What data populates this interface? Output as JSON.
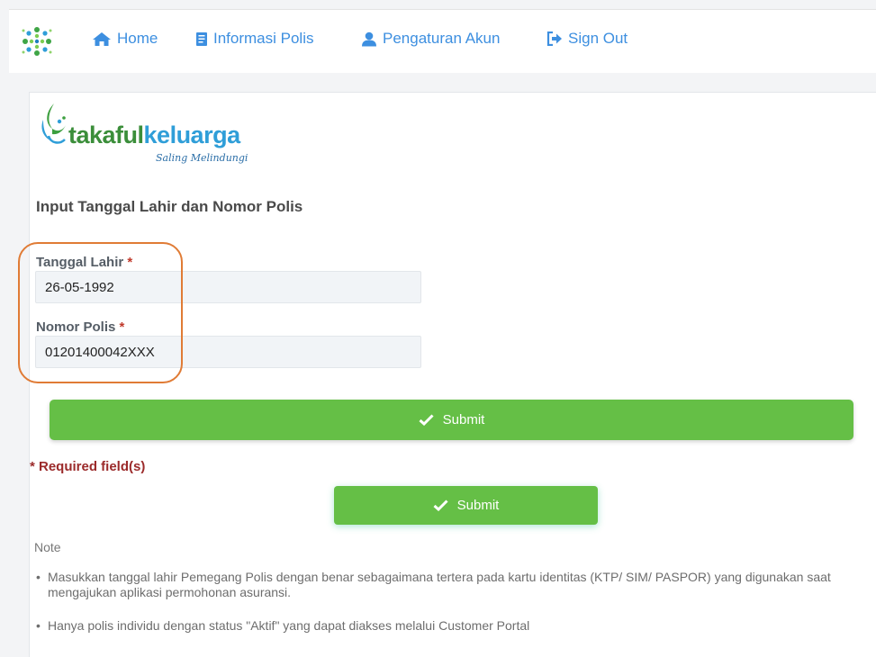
{
  "nav": {
    "home": "Home",
    "informasi_polis": "Informasi Polis",
    "pengaturan_akun": "Pengaturan Akun",
    "sign_out": "Sign Out",
    "link_color": "#3d8fe0"
  },
  "logo": {
    "brand_part1": "takaful",
    "brand_part2": "keluarga",
    "tagline": "Saling Melindungi"
  },
  "form": {
    "title": "Input Tanggal Lahir dan Nomor Polis",
    "birth_label": "Tanggal Lahir",
    "birth_value": "26-05-1992",
    "policy_label": "Nomor Polis",
    "policy_value": "01201400042XXX",
    "required_marker": "*",
    "submit_label": "Submit",
    "submit_label_2": "Submit",
    "required_note": "* Required field(s)"
  },
  "note": {
    "title": "Note",
    "bullet": "•",
    "items": [
      "Masukkan tanggal lahir Pemegang Polis dengan benar sebagaimana tertera pada kartu identitas (KTP/ SIM/ PASPOR) yang digunakan saat mengajukan aplikasi permohonan asuransi.",
      "Hanya polis individu dengan status \"Aktif\" yang dapat diakses melalui Customer Portal"
    ]
  },
  "colors": {
    "accent_green": "#65bf46",
    "highlight_orange": "#e07b35",
    "required_red": "#9b2a2a"
  }
}
